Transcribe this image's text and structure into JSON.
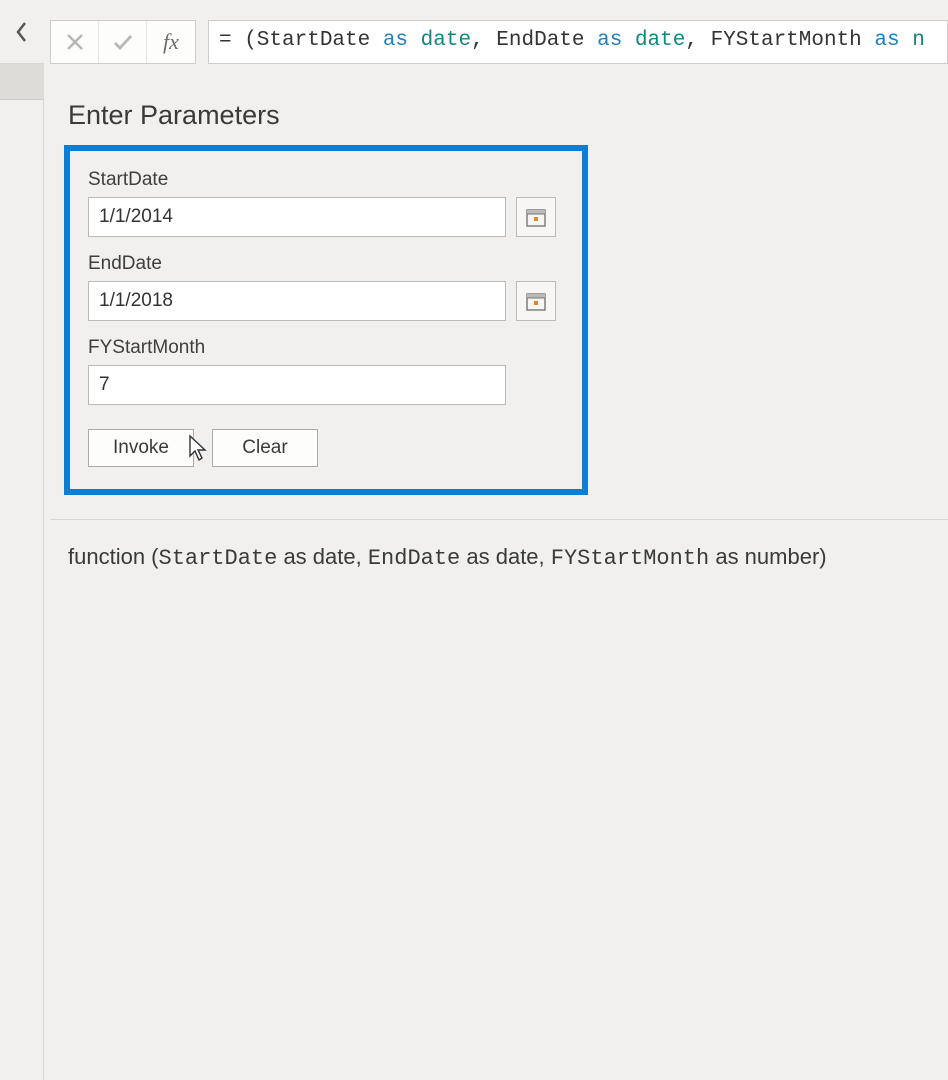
{
  "formula": {
    "prefix": "= (StartDate ",
    "kw1": "as",
    "sp1": " ",
    "ty1": "date",
    "mid1": ", EndDate ",
    "kw2": "as",
    "sp2": " ",
    "ty2": "date",
    "mid2": ", FYStartMonth ",
    "kw3": "as",
    "sp3": " ",
    "ty3": "n"
  },
  "section": {
    "title": "Enter Parameters"
  },
  "fields": {
    "startDate": {
      "label": "StartDate",
      "value": "1/1/2014"
    },
    "endDate": {
      "label": "EndDate",
      "value": "1/1/2018"
    },
    "fyStart": {
      "label": "FYStartMonth",
      "value": "7"
    }
  },
  "buttons": {
    "invoke": "Invoke",
    "clear": "Clear"
  },
  "signature": {
    "p0": "function (",
    "a0": "StartDate",
    "p1": " as date, ",
    "a1": "EndDate",
    "p2": " as date, ",
    "a2": "FYStartMonth",
    "p3": " as number) "
  }
}
